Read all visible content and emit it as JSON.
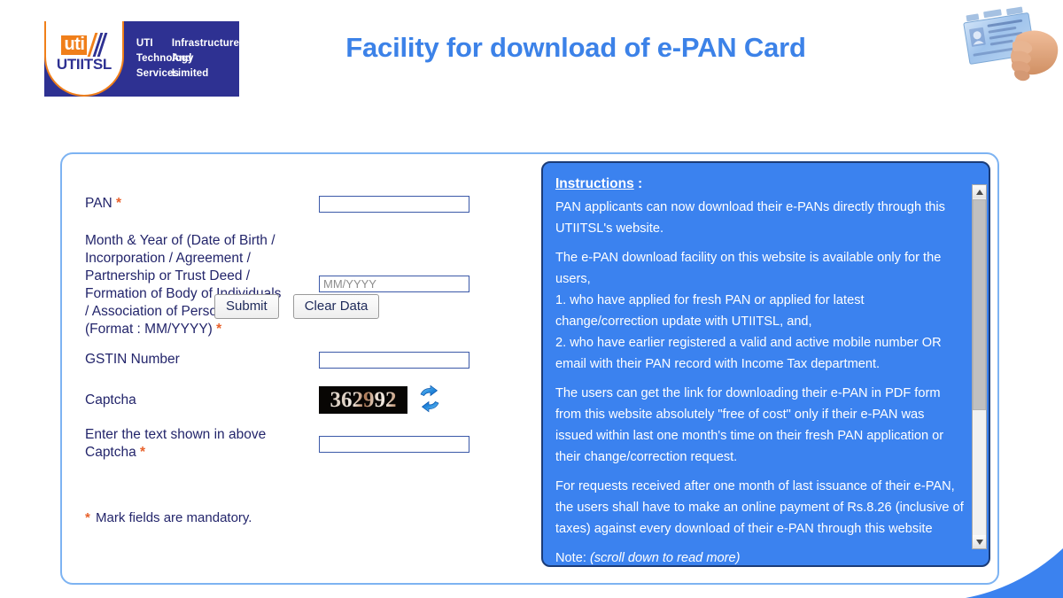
{
  "header": {
    "title": "Facility for download of e-PAN Card",
    "logo": {
      "mark_primary": "uti",
      "mark_secondary": "UTIITSL",
      "line1_col1": "UTI",
      "line1_col2": "Infrastructure",
      "line2_col1": "Technology",
      "line2_col2": "And",
      "line3_col1": "Services",
      "line3_col2": "Limited"
    },
    "illustration_alt": "hand-holding-pan-card"
  },
  "form": {
    "fields": [
      {
        "label": "PAN",
        "required": true,
        "value": "",
        "placeholder": ""
      },
      {
        "label": "Month & Year of (Date of Birth / Incorporation / Agreement / Partnership or Trust Deed / Formation of Body of Individuals / Association of Persons) (Format : MM/YYYY)",
        "required": true,
        "value": "",
        "placeholder": "MM/YYYY"
      },
      {
        "label": "GSTIN Number",
        "required": false,
        "value": "",
        "placeholder": ""
      },
      {
        "label": "Captcha",
        "required": false,
        "value": "",
        "placeholder": ""
      },
      {
        "label": "Enter the text shown in above Captcha",
        "required": true,
        "value": "",
        "placeholder": ""
      }
    ],
    "pan_label": "PAN",
    "dob_label_lines": [
      "Month & Year of (Date of Birth /",
      "Incorporation / Agreement /",
      "Partnership or Trust Deed /",
      "Formation of Body of Individuals",
      "/ Association of Persons)",
      "(Format : MM/YYYY)"
    ],
    "gstin_label": "GSTIN Number",
    "captcha_label": "Captcha",
    "captcha_entry_label_lines": [
      "Enter the text shown in above",
      "Captcha"
    ],
    "dob_placeholder": "MM/YYYY",
    "captcha_code": "362992",
    "refresh_icon": "refresh-icon",
    "submit_label": "Submit",
    "clear_label": "Clear Data",
    "mandatory_note": "Mark fields are mandatory.",
    "asterisk": "*"
  },
  "instructions": {
    "title": "Instructions",
    "title_colon": " :",
    "paragraphs": [
      "PAN applicants can now download their e-PANs directly through this UTIITSL's website.",
      "The e-PAN download facility on this website is available only for the users,",
      "1. who have applied for fresh PAN or applied for latest change/correction update with UTIITSL, and,",
      "2. who have earlier registered a valid and active mobile number OR email with their PAN record with Income Tax department.",
      "The users can get the link for downloading their e-PAN in PDF form from this website absolutely \"free of cost\" only if their e-PAN was issued within last one month's time on their fresh PAN application or their change/correction request.",
      "For requests received after one month of last issuance of their e-PAN, the users shall have to make an online payment of Rs.8.26 (inclusive of taxes) against every download of their e-PAN through this website"
    ],
    "note_label": "Note:",
    "note_text": "(scroll down to read more)",
    "scrollbar": {
      "up_icon": "scroll-up-arrow-icon",
      "down_icon": "scroll-down-arrow-icon"
    }
  },
  "colors": {
    "title_blue": "#3c82e8",
    "label_navy": "#23256b",
    "required_orange": "#e8622c",
    "panel_border": "#7db3f2",
    "instructions_bg": "#3b82ef",
    "instructions_border": "#1b3c78",
    "logo_blue": "#2e3192",
    "logo_orange": "#f07f1a"
  }
}
